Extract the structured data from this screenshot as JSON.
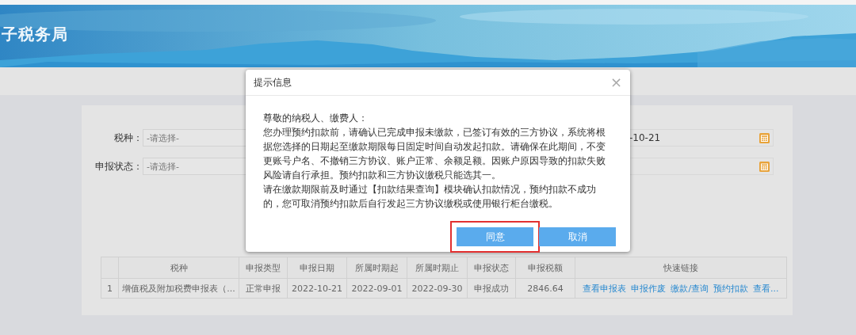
{
  "banner": {
    "title": "子税务局"
  },
  "form": {
    "rows": [
      {
        "label": "税种：",
        "placeholder": "-请选择-",
        "date_value": "-10-21"
      },
      {
        "label": "申报状态：",
        "placeholder": "-请选择-",
        "date_value": ""
      }
    ]
  },
  "table": {
    "columns": [
      "",
      "税种",
      "申报类型",
      "申报日期",
      "所属时期起",
      "所属时期止",
      "申报状态",
      "申报税额",
      "快速链接"
    ],
    "rows": [
      {
        "cells": [
          "1",
          "增值税及附加税费申报表（...",
          "正常申报",
          "2022-10-21",
          "2022-09-01",
          "2022-09-30",
          "申报成功",
          "2846.64"
        ],
        "links": [
          "查看申报表",
          "申报作废",
          "缴款/查询",
          "预约扣款",
          "查看..."
        ]
      }
    ]
  },
  "dialog": {
    "title": "提示信息",
    "close": "×",
    "paragraphs": [
      "尊敬的纳税人、缴费人：",
      "您办理预约扣款前，请确认已完成申报未缴款，已签订有效的三方协议，系统将根据您选择的日期起至缴款期限每日固定时间自动发起扣款。请确保在此期间，不变更账号户名、不撤销三方协议、账户正常、余额足额。因账户原因导致的扣款失败风险请自行承担。预约扣款和三方协议缴税只能选其一。",
      "请在缴款期限前及时通过【扣款结果查询】模块确认扣款情况，预约扣款不成功的，您可取消预约扣款后自行发起三方协议缴税或使用银行柜台缴税。"
    ],
    "buttons": [
      {
        "label": "同意",
        "highlighted": true
      },
      {
        "label": "取消",
        "highlighted": false
      }
    ]
  }
}
